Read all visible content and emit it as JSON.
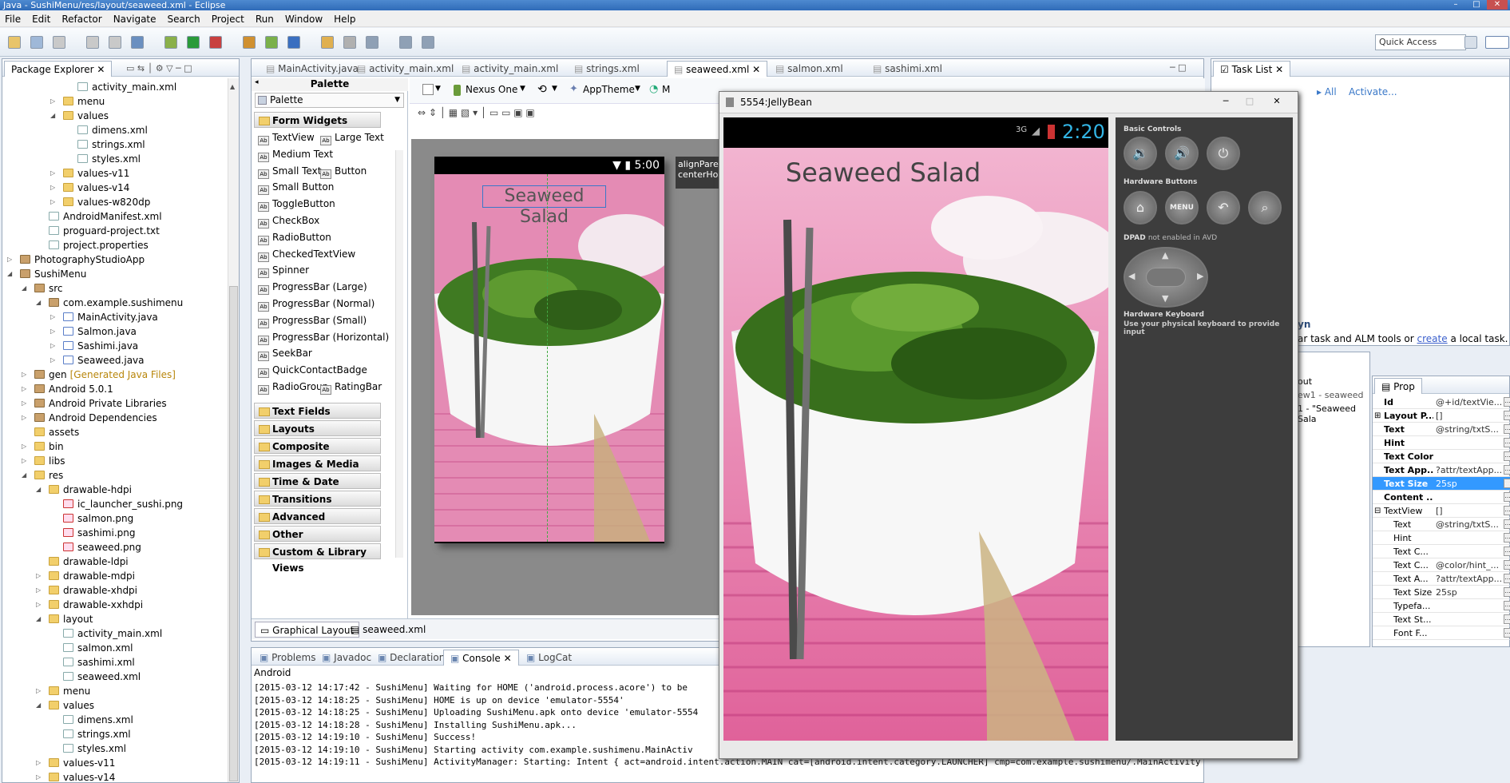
{
  "window": {
    "title": "Java - SushiMenu/res/layout/seaweed.xml - Eclipse"
  },
  "menu": [
    "File",
    "Edit",
    "Refactor",
    "Navigate",
    "Search",
    "Project",
    "Run",
    "Window",
    "Help"
  ],
  "toolbar": {
    "quick_access": "Quick Access"
  },
  "package_explorer": {
    "tab_label": "Package Explorer",
    "items": [
      {
        "label": "activity_main.xml",
        "icon": "xml"
      },
      {
        "label": "menu",
        "icon": "folder"
      },
      {
        "label": "values",
        "icon": "folder"
      },
      {
        "label": "dimens.xml",
        "icon": "xml"
      },
      {
        "label": "strings.xml",
        "icon": "xml"
      },
      {
        "label": "styles.xml",
        "icon": "xml"
      },
      {
        "label": "values-v11",
        "icon": "folder"
      },
      {
        "label": "values-v14",
        "icon": "folder"
      },
      {
        "label": "values-w820dp",
        "icon": "folder"
      },
      {
        "label": "AndroidManifest.xml",
        "icon": "xml"
      },
      {
        "label": "proguard-project.txt",
        "icon": "xml"
      },
      {
        "label": "project.properties",
        "icon": "xml"
      },
      {
        "label": "PhotographyStudioApp",
        "icon": "project"
      },
      {
        "label": "SushiMenu",
        "icon": "project"
      },
      {
        "label": "src",
        "icon": "package"
      },
      {
        "label": "com.example.sushimenu",
        "icon": "package"
      },
      {
        "label": "MainActivity.java",
        "icon": "java"
      },
      {
        "label": "Salmon.java",
        "icon": "java"
      },
      {
        "label": "Sashimi.java",
        "icon": "java"
      },
      {
        "label": "Seaweed.java",
        "icon": "java"
      },
      {
        "label": "gen",
        "icon": "package",
        "suffix": "[Generated Java Files]"
      },
      {
        "label": "Android 5.0.1",
        "icon": "package"
      },
      {
        "label": "Android Private Libraries",
        "icon": "package"
      },
      {
        "label": "Android Dependencies",
        "icon": "package"
      },
      {
        "label": "assets",
        "icon": "folder"
      },
      {
        "label": "bin",
        "icon": "folder"
      },
      {
        "label": "libs",
        "icon": "folder"
      },
      {
        "label": "res",
        "icon": "folder"
      },
      {
        "label": "drawable-hdpi",
        "icon": "folder"
      },
      {
        "label": "ic_launcher_sushi.png",
        "icon": "png"
      },
      {
        "label": "salmon.png",
        "icon": "png"
      },
      {
        "label": "sashimi.png",
        "icon": "png"
      },
      {
        "label": "seaweed.png",
        "icon": "png"
      },
      {
        "label": "drawable-ldpi",
        "icon": "folder"
      },
      {
        "label": "drawable-mdpi",
        "icon": "folder"
      },
      {
        "label": "drawable-xhdpi",
        "icon": "folder"
      },
      {
        "label": "drawable-xxhdpi",
        "icon": "folder"
      },
      {
        "label": "layout",
        "icon": "folder"
      },
      {
        "label": "activity_main.xml",
        "icon": "xml"
      },
      {
        "label": "salmon.xml",
        "icon": "xml"
      },
      {
        "label": "sashimi.xml",
        "icon": "xml"
      },
      {
        "label": "seaweed.xml",
        "icon": "xml"
      },
      {
        "label": "menu",
        "icon": "folder"
      },
      {
        "label": "values",
        "icon": "folder"
      },
      {
        "label": "dimens.xml",
        "icon": "xml"
      },
      {
        "label": "strings.xml",
        "icon": "xml"
      },
      {
        "label": "styles.xml",
        "icon": "xml"
      },
      {
        "label": "values-v11",
        "icon": "folder"
      },
      {
        "label": "values-v14",
        "icon": "folder"
      }
    ]
  },
  "editor_tabs": [
    "MainActivity.java",
    "activity_main.xml",
    "activity_main.xml",
    "strings.xml",
    "seaweed.xml",
    "salmon.xml",
    "sashimi.xml"
  ],
  "active_editor_tab": "seaweed.xml",
  "palette": {
    "title": "Palette",
    "dropdown": "Palette",
    "open_category": "Form Widgets",
    "widgets": [
      [
        "TextView",
        "Large Text"
      ],
      [
        "Medium Text"
      ],
      [
        "Small Text",
        "Button"
      ],
      [
        "Small Button"
      ],
      [
        "ToggleButton"
      ],
      [
        "CheckBox"
      ],
      [
        "RadioButton"
      ],
      [
        "CheckedTextView"
      ],
      [
        "Spinner"
      ],
      [
        "ProgressBar (Large)"
      ],
      [
        "ProgressBar (Normal)"
      ],
      [
        "ProgressBar (Small)"
      ],
      [
        "ProgressBar (Horizontal)"
      ],
      [
        "SeekBar"
      ],
      [
        "QuickContactBadge"
      ],
      [
        "RadioGroup",
        "RatingBar"
      ]
    ],
    "categories": [
      "Text Fields",
      "Layouts",
      "Composite",
      "Images & Media",
      "Time & Date",
      "Transitions",
      "Advanced",
      "Other",
      "Custom & Library Views"
    ]
  },
  "layout_toolbar": {
    "device": "Nexus One",
    "theme": "AppTheme",
    "more": "M"
  },
  "preview": {
    "status_time": "5:00",
    "text": "Seaweed Salad",
    "hint_lines": [
      "alignParentT",
      "centerHorizo"
    ]
  },
  "editor_bottom_tabs": [
    "Graphical Layout",
    "seaweed.xml"
  ],
  "console": {
    "tabs": [
      "Problems",
      "Javadoc",
      "Declaration",
      "Console",
      "LogCat"
    ],
    "active": "Console",
    "header": "Android",
    "lines": [
      "[2015-03-12 14:17:42 - SushiMenu] Waiting for HOME ('android.process.acore') to be",
      "[2015-03-12 14:18:25 - SushiMenu] HOME is up on device 'emulator-5554'",
      "[2015-03-12 14:18:25 - SushiMenu] Uploading SushiMenu.apk onto device 'emulator-5554",
      "[2015-03-12 14:18:28 - SushiMenu] Installing SushiMenu.apk...",
      "[2015-03-12 14:19:10 - SushiMenu] Success!",
      "[2015-03-12 14:19:10 - SushiMenu] Starting activity com.example.sushimenu.MainActiv",
      "[2015-03-12 14:19:11 - SushiMenu] ActivityManager: Starting: Intent { act=android.intent.action.MAIN cat=[android.intent.category.LAUNCHER] cmp=com.example.sushimenu/.MainActivity }"
    ]
  },
  "tasklist": {
    "tab_label": "Task List",
    "all": "All",
    "activate": "Activate...",
    "hint_suffix": "ar task and ALM tools or",
    "create_link": "create",
    "hint_end": "a local task.",
    "title_partial": "yn"
  },
  "outline": {
    "line1": "out",
    "line2": "ew1 - seaweed",
    "line3": "1 - \"Seaweed Sala"
  },
  "properties": {
    "tab_label": "Prop",
    "rows": [
      {
        "k": "Id",
        "v": "@+id/textVie...",
        "bold": true
      },
      {
        "k": "Layout P...",
        "v": "[]",
        "bold": true,
        "exp": "+"
      },
      {
        "k": "Text",
        "v": "@string/txtS...",
        "bold": true
      },
      {
        "k": "Hint",
        "v": "",
        "bold": true
      },
      {
        "k": "Text Color",
        "v": "",
        "bold": true
      },
      {
        "k": "Text App...",
        "v": "?attr/textApp...",
        "bold": true
      },
      {
        "k": "Text Size",
        "v": "25sp",
        "bold": true,
        "sel": true
      },
      {
        "k": "Content ...",
        "v": "",
        "bold": true
      },
      {
        "k": "TextView",
        "v": "[]",
        "bold": false,
        "exp": "-"
      },
      {
        "k": "Text",
        "v": "@string/txtS...",
        "bold": false,
        "sub": true
      },
      {
        "k": "Hint",
        "v": "",
        "bold": false,
        "sub": true
      },
      {
        "k": "Text C...",
        "v": "",
        "bold": false,
        "sub": true
      },
      {
        "k": "Text C...",
        "v": "@color/hint_...",
        "bold": false,
        "sub": true
      },
      {
        "k": "Text A...",
        "v": "?attr/textApp...",
        "bold": false,
        "sub": true
      },
      {
        "k": "Text Size",
        "v": "25sp",
        "bold": false,
        "sub": true
      },
      {
        "k": "Typefa...",
        "v": "",
        "bold": false,
        "sub": true
      },
      {
        "k": "Text St...",
        "v": "",
        "bold": false,
        "sub": true
      },
      {
        "k": "Font F...",
        "v": "",
        "bold": false,
        "sub": true
      }
    ]
  },
  "emulator": {
    "title": "5554:JellyBean",
    "network": "3G",
    "time": "2:20",
    "app_text": "Seaweed Salad",
    "basic_controls": "Basic Controls",
    "hardware_buttons": "Hardware Buttons",
    "menu_label": "MENU",
    "dpad": "DPAD",
    "dpad_note": "not enabled in AVD",
    "keyboard_title": "Hardware Keyboard",
    "keyboard_note": "Use your physical keyboard to provide input"
  },
  "colors": {
    "accent_blue": "#3a78c8",
    "emulator_time": "#33b5e5",
    "pink": "#e8a0c0"
  }
}
